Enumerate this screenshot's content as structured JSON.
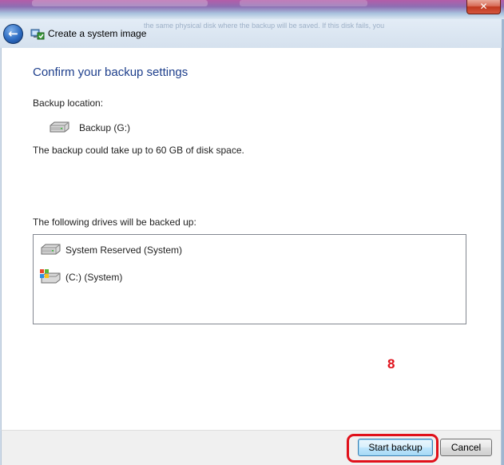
{
  "window": {
    "title": "Create a system image",
    "ghost_text": "the same physical disk where the backup will be saved. If this disk fails, you",
    "close_glyph": "✕",
    "back_glyph": "←"
  },
  "page": {
    "heading": "Confirm your backup settings",
    "backup_location_label": "Backup location:",
    "backup_drive": "Backup (G:)",
    "space_text": "The backup could take up to 60 GB of disk space.",
    "drives_label": "The following drives will be backed up:",
    "drives": [
      {
        "label": "System Reserved (System)",
        "icon": "hard-drive-icon"
      },
      {
        "label": "(C:) (System)",
        "icon": "windows-drive-icon"
      }
    ]
  },
  "annotation": {
    "step_number": "8",
    "color": "#e0101a"
  },
  "buttons": {
    "start_backup": "Start backup",
    "cancel": "Cancel"
  },
  "colors": {
    "heading": "#1e3f8c",
    "close_button": "#c0391f",
    "accent_button": "#3c7fb1"
  }
}
